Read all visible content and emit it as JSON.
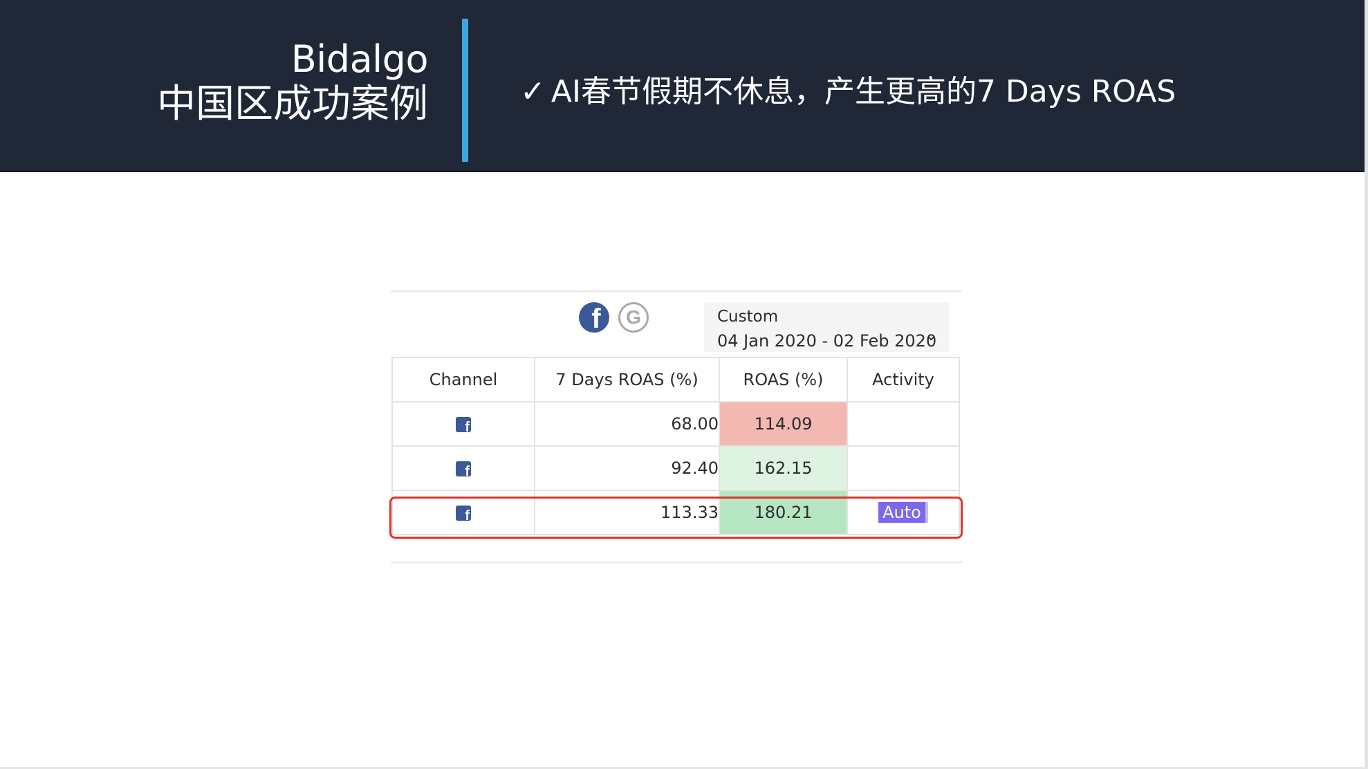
{
  "header": {
    "title_en": "Bidalgo",
    "title_zh": "中国区成功案例",
    "headline_check": "✓",
    "headline": "AI春节假期不休息，产生更高的7 Days ROAS",
    "band_color": "#202737",
    "accent_color": "#3ea6dc"
  },
  "toolbar": {
    "facebook_icon": "f",
    "google_icon": "G",
    "date_label": "Custom",
    "date_range": "04 Jan 2020 - 02 Feb 2020",
    "chevron": "⌄"
  },
  "table": {
    "headers": [
      "Channel",
      "7 Days ROAS (%)",
      "ROAS (%)",
      "Activity"
    ],
    "rows": [
      {
        "channel_icon": "f",
        "roas7": "68.00",
        "roas": "114.09",
        "roas_color": "#f4b8b2",
        "activity": ""
      },
      {
        "channel_icon": "f",
        "roas7": "92.40",
        "roas": "162.15",
        "roas_color": "#dff3e2",
        "activity": ""
      },
      {
        "channel_icon": "f",
        "roas7": "113.33",
        "roas": "180.21",
        "roas_color": "#b7e6c3",
        "activity": "Auto"
      }
    ],
    "badge_color": "#7b68ee",
    "highlight_color": "#e3332d"
  }
}
